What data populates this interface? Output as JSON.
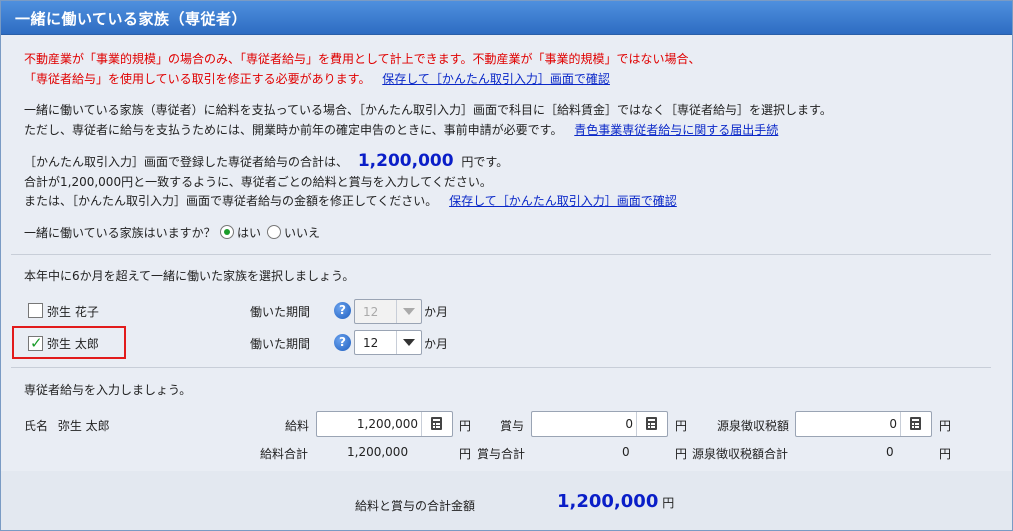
{
  "title": "一緒に働いている家族（専従者）",
  "notice": {
    "line1": "不動産業が「事業的規模」の場合のみ、「専従者給与」を費用として計上できます。不動産業が「事業的規模」ではない場合、",
    "line2": "「専従者給与」を使用している取引を修正する必要があります。",
    "link": "保存して［かんたん取引入力］画面で確認"
  },
  "info": {
    "line1": "一緒に働いている家族（専従者）に給料を支払っている場合、［かんたん取引入力］画面で科目に［給料賃金］ではなく［専従者給与］を選択します。",
    "line2": "ただし、専従者に給与を支払うためには、開業時か前年の確定申告のときに、事前申請が必要です。",
    "link": "青色事業専従者給与に関する届出手続"
  },
  "total_info": {
    "prefix": "［かんたん取引入力］画面で登録した専従者給与の合計は、",
    "amount": "1,200,000",
    "suffix": "円です。",
    "line2": "合計が1,200,000円と一致するように、専従者ごとの給料と賞与を入力してください。",
    "line3": "または、［かんたん取引入力］画面で専従者給与の金額を修正してください。",
    "link": "保存して［かんたん取引入力］画面で確認"
  },
  "question": {
    "label": "一緒に働いている家族はいますか？",
    "yes": "はい",
    "no": "いいえ",
    "selected": "yes"
  },
  "select_prompt": "本年中に6か月を超えて一緒に働いた家族を選択しましょう。",
  "family": [
    {
      "name": "弥生 花子",
      "checked": false,
      "period_label": "働いた期間",
      "months": "12",
      "unit": "か月"
    },
    {
      "name": "弥生 太郎",
      "checked": true,
      "period_label": "働いた期間",
      "months": "12",
      "unit": "か月"
    }
  ],
  "salary_prompt": "専従者給与を入力しましょう。",
  "employee": {
    "name_label": "氏名",
    "name": "弥生 太郎",
    "salary_label": "給料",
    "salary": "1,200,000",
    "bonus_label": "賞与",
    "bonus": "0",
    "tax_label": "源泉徴収税額",
    "tax": "0",
    "yen": "円",
    "salary_total_label": "給料合計",
    "salary_total": "1,200,000",
    "bonus_total_label": "賞与合計",
    "bonus_total": "0",
    "tax_total_label": "源泉徴収税額合計",
    "tax_total": "0"
  },
  "grand_total": {
    "label": "給料と賞与の合計金額",
    "amount": "1,200,000",
    "unit": "円"
  },
  "colors": {
    "header": "#3a7ad0",
    "warning": "#e00000",
    "amount": "#0a1ec8",
    "highlight": "#e21b1b"
  }
}
